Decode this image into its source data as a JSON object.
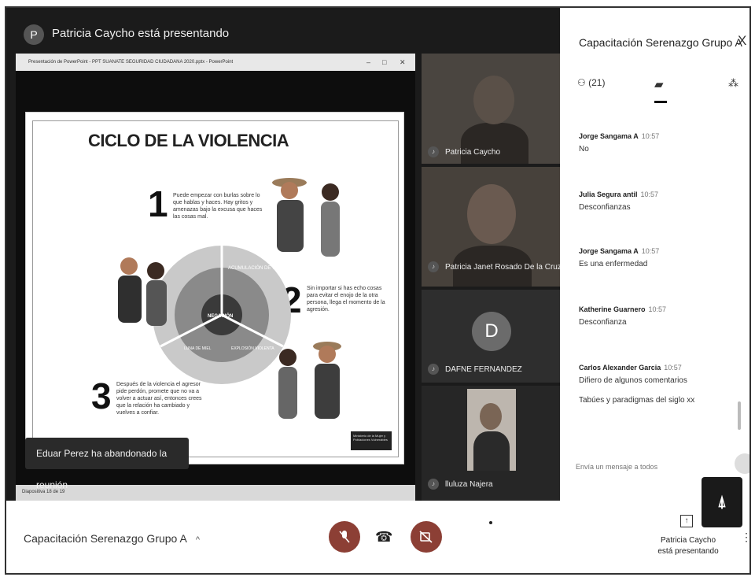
{
  "presenter_bar": {
    "avatar_letter": "P",
    "title": "Patricia Caycho está presentando"
  },
  "ppt_window": {
    "title": "Presentación de PowerPoint - PPT SUANATE SEGURIDAD CIUDADANA 2020.pptx - PowerPoint",
    "controls": [
      "–",
      "□",
      "✕"
    ],
    "status": "Diapositiva 18 de 19"
  },
  "slide": {
    "title": "CICLO DE LA VIOLENCIA",
    "steps": [
      {
        "num": "1",
        "text": "Puede empezar con burlas sobre lo que hablas y haces. Hay gritos y amenazas bajo la excusa que haces las cosas mal."
      },
      {
        "num": "2",
        "text": "Sin importar si has echo cosas para evitar el enojo de la otra persona, llega el momento de la agresión."
      },
      {
        "num": "3",
        "text": "Después de la violencia el agresor pide perdón, promete que no va a volver a actuar así, entonces crees que la relación ha cambiado y vuelves a confiar."
      }
    ],
    "cycle_labels": [
      "ACUMULACIÓN DE TENSIÓN",
      "NEGACIÓN",
      "EXPLOSIÓN VIOLENTA",
      "LUNA DE MIEL"
    ],
    "footer_logo": "Ministerio de la Mujer y Poblaciones Vulnerables"
  },
  "toast": "Eduar Perez ha abandonado la reunión",
  "participants": [
    {
      "name": "Patricia Caycho"
    },
    {
      "name": "Patricia Janet Rosado De la Cruz"
    },
    {
      "name": "DAFNE FERNANDEZ",
      "avatar_letter": "D"
    },
    {
      "name": "lluluza Najera"
    }
  ],
  "chat": {
    "title": "Capacitación Serenazgo Grupo A",
    "close": "X",
    "tabs": [
      {
        "label": "(21)",
        "icon": "people-icon"
      },
      {
        "label": "",
        "icon": "chat-icon"
      },
      {
        "label": "",
        "icon": "activities-icon"
      }
    ],
    "messages": [
      {
        "sender": "Jorge Sangama A",
        "time": "10:57",
        "lines": [
          "No"
        ]
      },
      {
        "sender": "Julia Segura antil",
        "time": "10:57",
        "lines": [
          "Desconfianzas"
        ]
      },
      {
        "sender": "Jorge Sangama A",
        "time": "10:57",
        "lines": [
          "Es una enfermedad"
        ]
      },
      {
        "sender": "Katherine Guarnero",
        "time": "10:57",
        "lines": [
          "Desconfianza"
        ]
      },
      {
        "sender": "Carlos Alexander Garcia",
        "time": "10:57",
        "lines": [
          "Difiero de algunos comentarios",
          "Tabúes y paradigmas del siglo xx"
        ]
      }
    ],
    "input_placeholder": "Envía un mensaje a todos"
  },
  "bottom_bar": {
    "meeting_name": "Capacitación Serenazgo Grupo A",
    "caret": "^",
    "present_label_line1": "Patricia Caycho",
    "present_label_line2": "está presentando"
  },
  "colors": {
    "control_red": "#8c3f35",
    "dark_bg": "#1b1b1b"
  }
}
